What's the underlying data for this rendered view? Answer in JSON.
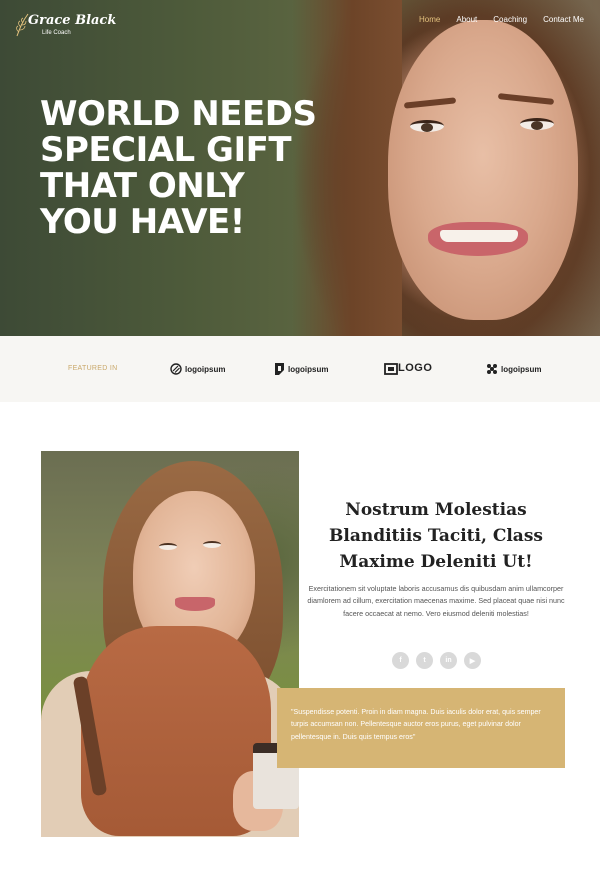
{
  "brand": {
    "name": "Grace Black",
    "tagline": "Life Coach"
  },
  "nav": {
    "items": [
      {
        "label": "Home",
        "active": true
      },
      {
        "label": "About",
        "active": false
      },
      {
        "label": "Coaching",
        "active": false
      },
      {
        "label": "Contact Me",
        "active": false
      }
    ]
  },
  "hero": {
    "headline_lines": [
      "WORLD NEEDS",
      "SPECIAL GIFT",
      "THAT ONLY",
      "YOU HAVE!"
    ]
  },
  "featured": {
    "label": "FEATURED IN",
    "logos": [
      {
        "text": "logoipsum",
        "icon": "circle-slash-logo-icon"
      },
      {
        "text": "logoipsum",
        "icon": "bracket-logo-icon"
      },
      {
        "text": "LOGO",
        "icon": "block-logo-icon"
      },
      {
        "text": "logoipsum",
        "icon": "cluster-logo-icon"
      }
    ]
  },
  "intro": {
    "title": "Nostrum Molestias Blanditiis Taciti, Class Maxime Deleniti Ut!",
    "body": "Exercitationem sit voluptate laboris accusamus dis quibusdam anim ullamcorper diamlorem ad cillum, exercitation maecenas maxime. Sed placeat quae nisi nunc facere occaecat at nemo. Vero eiusmod deleniti molestias!",
    "socials": [
      {
        "icon": "facebook-icon",
        "glyph": "f"
      },
      {
        "icon": "twitter-icon",
        "glyph": "t"
      },
      {
        "icon": "linkedin-icon",
        "glyph": "in"
      },
      {
        "icon": "youtube-icon",
        "glyph": "▶"
      }
    ],
    "quote": "\"Suspendisse potenti. Proin in diam magna. Duis iaculis dolor erat, quis semper turpis accumsan non. Pellentesque auctor eros purus, eget pulvinar dolor pellentesque in. Duis quis tempus eros\""
  },
  "colors": {
    "accent": "#d6b574",
    "nav_active": "#e3c27e",
    "featured_bg": "#f7f6f3"
  }
}
